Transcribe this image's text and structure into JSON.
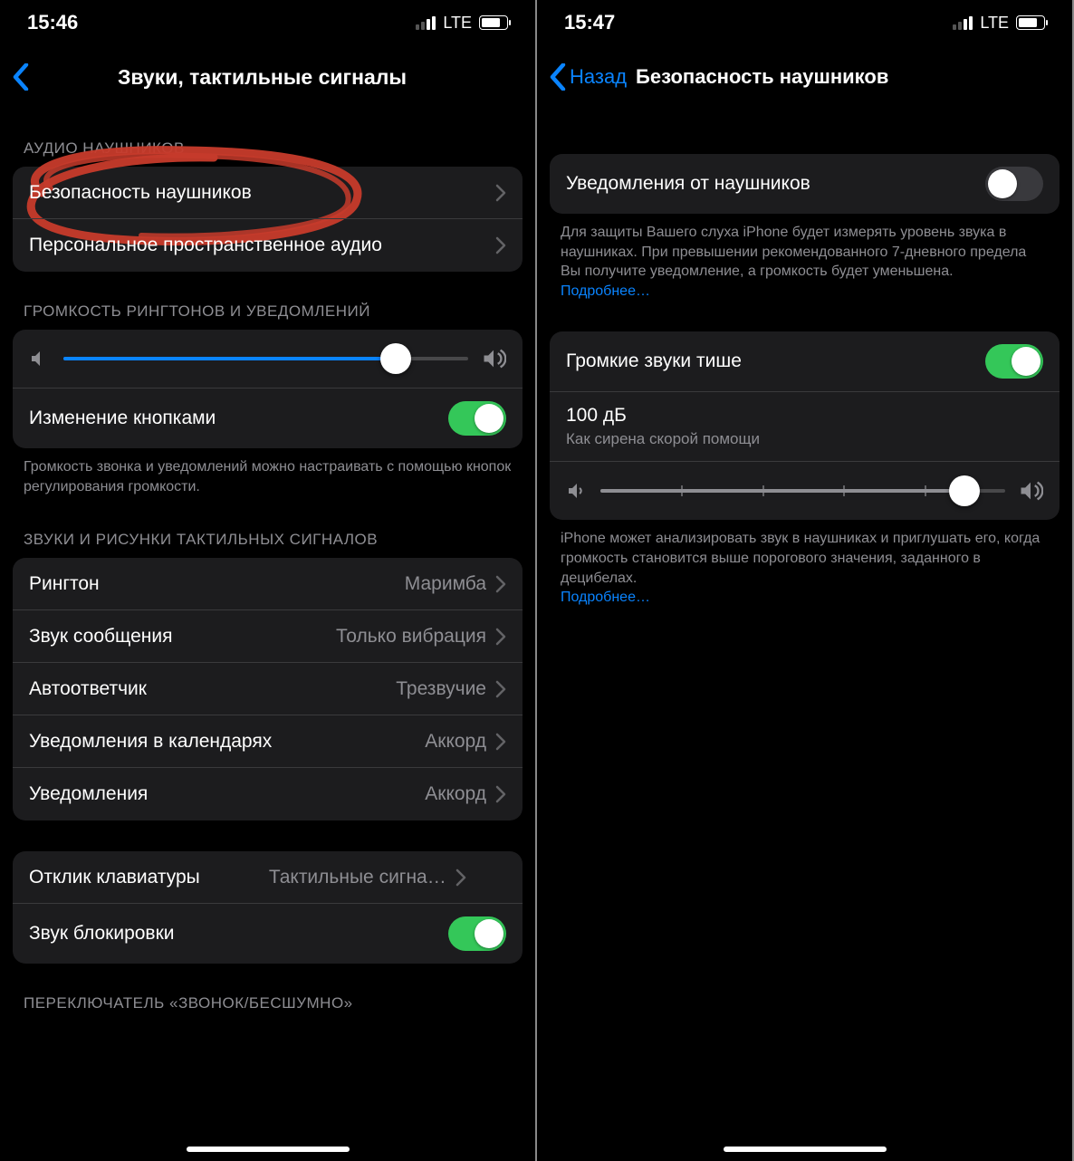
{
  "left": {
    "status": {
      "time": "15:46",
      "net": "LTE"
    },
    "nav": {
      "title": "Звуки, тактильные сигналы"
    },
    "sections": {
      "audio_header": "АУДИО НАУШНИКОВ",
      "headphone_safety": "Безопасность наушников",
      "spatial": "Персональное пространственное аудио",
      "volume_header": "ГРОМКОСТЬ РИНГТОНОВ И УВЕДОМЛЕНИЙ",
      "change_buttons": "Изменение кнопками",
      "volume_footer": "Громкость звонка и уведомлений можно настраивать с помощью кнопок регулирования громкости.",
      "sounds_header": "ЗВУКИ И РИСУНКИ ТАКТИЛЬНЫХ СИГНАЛОВ",
      "ringtone_label": "Рингтон",
      "ringtone_value": "Маримба",
      "text_label": "Звук сообщения",
      "text_value": "Только вибрация",
      "voicemail_label": "Автоответчик",
      "voicemail_value": "Трезвучие",
      "calendar_label": "Уведомления в календарях",
      "calendar_value": "Аккорд",
      "reminders_label": "Уведомления",
      "reminders_value": "Аккорд",
      "keyboard_label": "Отклик клавиатуры",
      "keyboard_value": "Тактильные сигна…",
      "lock_label": "Звук блокировки",
      "switch_header": "ПЕРЕКЛЮЧАТЕЛЬ «ЗВОНОК/БЕСШУМНО»"
    },
    "slider": {
      "percent": 82
    }
  },
  "right": {
    "status": {
      "time": "15:47",
      "net": "LTE"
    },
    "nav": {
      "back": "Назад",
      "title": "Безопасность наушников"
    },
    "notif_label": "Уведомления от наушников",
    "notif_footer": "Для защиты Вашего слуха iPhone будет измерять уровень звука в наушниках. При превышении рекомендованного 7-дневного предела Вы получите уведомление, а громкость будет уменьшена.",
    "more": "Подробнее…",
    "reduce_label": "Громкие звуки тише",
    "db_value": "100 дБ",
    "db_sub": "Как сирена скорой помощи",
    "reduce_footer": "iPhone может анализировать звук в наушниках и приглушать его, когда громкость становится выше порогового значения, заданного в децибелах.",
    "slider": {
      "percent": 90
    }
  }
}
